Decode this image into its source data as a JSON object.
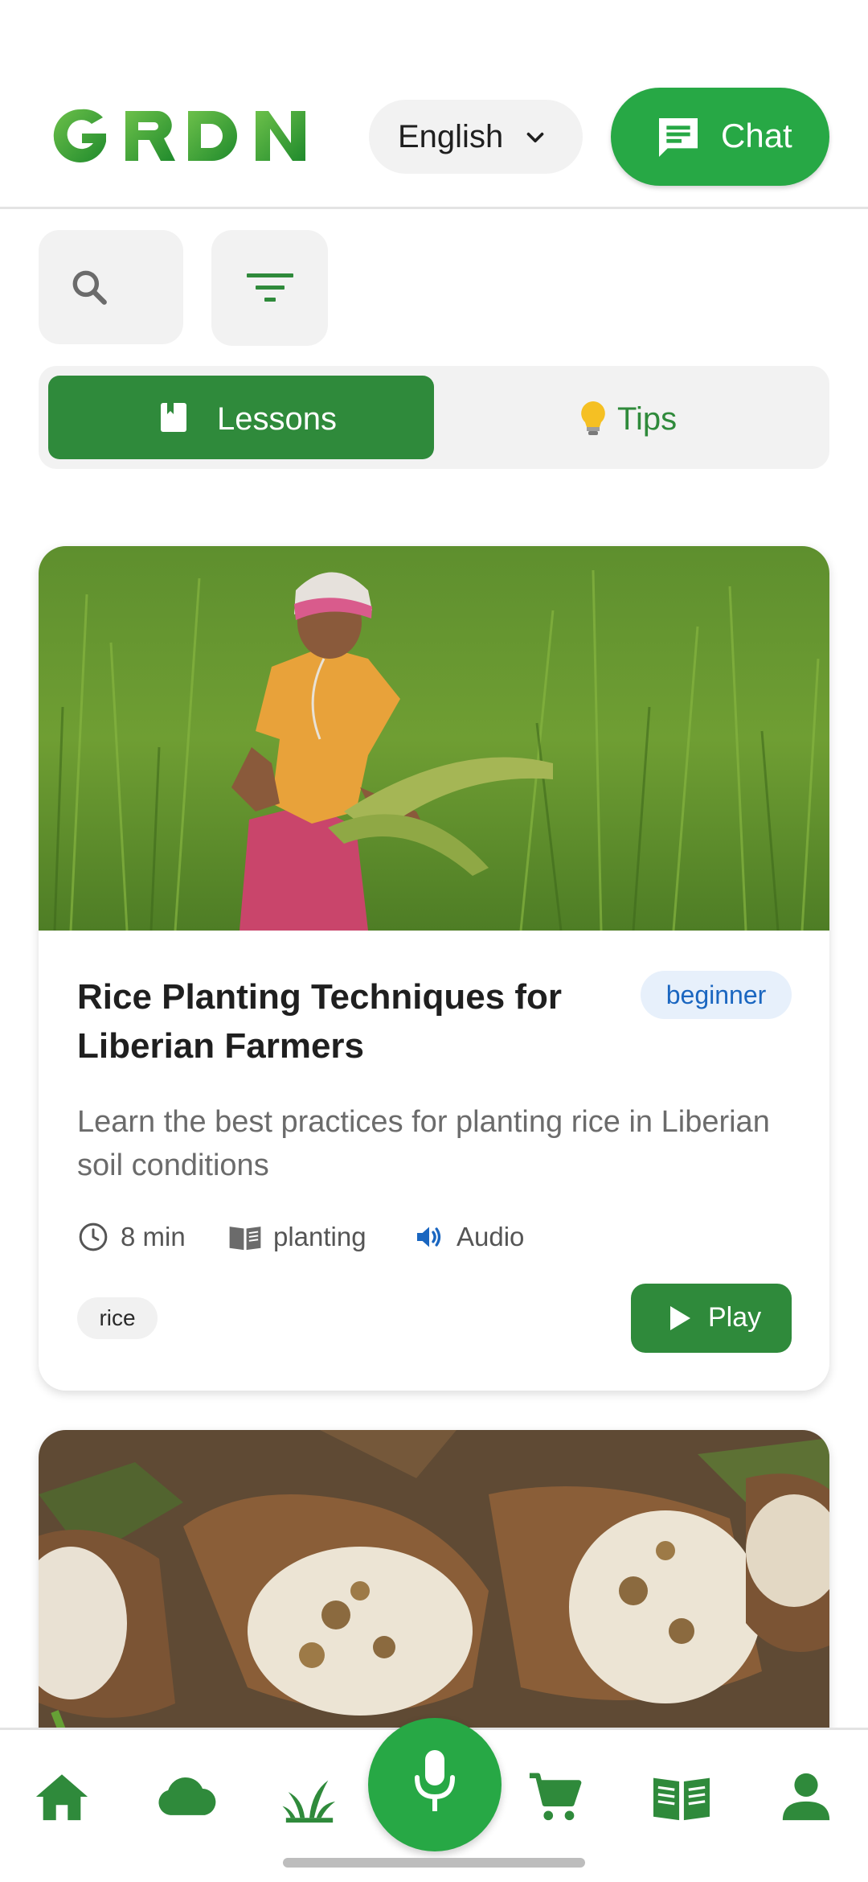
{
  "header": {
    "logo_text": "GRDN",
    "language": {
      "selected": "English"
    },
    "chat_label": "Chat"
  },
  "toolbar": {
    "search_icon": "search-icon",
    "filter_icon": "filter-icon"
  },
  "tabs": [
    {
      "label": "Lessons",
      "icon": "book-icon",
      "active": true
    },
    {
      "label": "Tips",
      "icon": "lightbulb-icon",
      "active": false
    }
  ],
  "lessons": [
    {
      "title": "Rice Planting Techniques for Liberian Farmers",
      "level": "beginner",
      "description": "Learn the best practices for planting rice in Liberian soil conditions",
      "duration": "8 min",
      "category": "planting",
      "media": "Audio",
      "tags": [
        "rice"
      ],
      "action": "Play"
    }
  ],
  "bottom_nav": [
    {
      "icon": "home-icon"
    },
    {
      "icon": "cloud-icon"
    },
    {
      "icon": "plant-icon"
    },
    {
      "icon": "microphone-icon"
    },
    {
      "icon": "cart-icon"
    },
    {
      "icon": "book-open-icon"
    },
    {
      "icon": "profile-icon"
    }
  ],
  "colors": {
    "brand_green": "#27a845",
    "dark_green": "#2f8a3b",
    "level_badge_bg": "#e7f0fb",
    "level_badge_text": "#1a66c0",
    "audio_icon": "#1a66c0"
  }
}
